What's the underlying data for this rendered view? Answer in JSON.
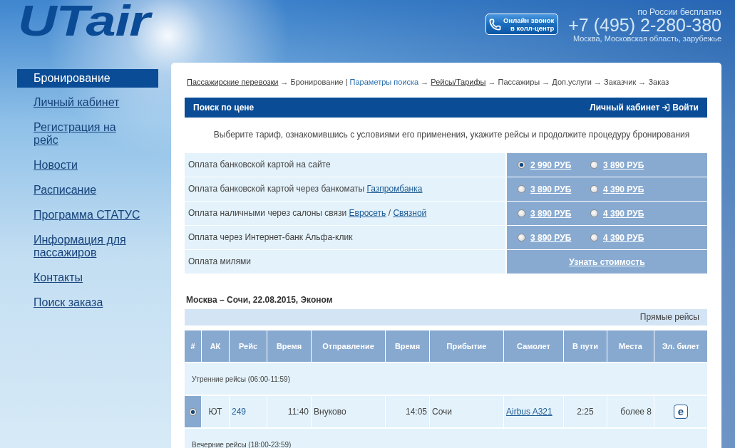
{
  "header": {
    "logo": "UTair",
    "callback_button": [
      "Онлайн звонок",
      "в колл-центр"
    ],
    "phone_note": "по России бесплатно",
    "phone": "+7 (495) 2-280-380",
    "phone_region": "Москва, Московская область, зарубежье"
  },
  "sidebar": {
    "items": [
      {
        "label": "Бронирование",
        "selected": true
      },
      {
        "label": "Личный кабинет",
        "selected": false
      },
      {
        "label": "Регистрация на рейс",
        "selected": false
      },
      {
        "label": "Новости",
        "selected": false
      },
      {
        "label": "Расписание",
        "selected": false
      },
      {
        "label": "Программа СТАТУС",
        "selected": false
      },
      {
        "label": "Информация для пассажиров",
        "selected": false
      },
      {
        "label": "Контакты",
        "selected": false
      },
      {
        "label": "Поиск заказа",
        "selected": false
      }
    ]
  },
  "breadcrumb": [
    {
      "text": "Пассажирские перевозки",
      "kind": "link"
    },
    {
      "text": " → Бронирование | ",
      "kind": "text"
    },
    {
      "text": "Параметры поиска",
      "kind": "current"
    },
    {
      "text": " → ",
      "kind": "text"
    },
    {
      "text": "Рейсы/Тарифы",
      "kind": "link"
    },
    {
      "text": " → Пассажиры → Доп.услуги → Заказчик → Заказ",
      "kind": "text"
    }
  ],
  "search_bar": {
    "title": "Поиск по цене",
    "account_link": "Личный кабинет",
    "login_link": "Войти"
  },
  "instruction": "Выберите тариф, ознакомившись с условиями его применения, укажите рейсы и продолжите процедуру бронирования",
  "payments": [
    {
      "kind": "fares",
      "label": [
        {
          "text": "Оплата банковской картой на сайте",
          "kind": "text"
        }
      ],
      "options": [
        {
          "price": "2 990 РУБ",
          "selected": true
        },
        {
          "price": "3 890 РУБ",
          "selected": false
        }
      ]
    },
    {
      "kind": "fares",
      "label": [
        {
          "text": "Оплата банковской картой через банкоматы ",
          "kind": "text"
        },
        {
          "text": "Газпромбанка",
          "kind": "link"
        }
      ],
      "options": [
        {
          "price": "3 890 РУБ",
          "selected": false
        },
        {
          "price": "4 390 РУБ",
          "selected": false
        }
      ]
    },
    {
      "kind": "fares",
      "label": [
        {
          "text": "Оплата наличными через салоны связи ",
          "kind": "text"
        },
        {
          "text": "Евросеть",
          "kind": "link"
        },
        {
          "text": " / ",
          "kind": "text"
        },
        {
          "text": "Связной",
          "kind": "link"
        }
      ],
      "options": [
        {
          "price": "3 890 РУБ",
          "selected": false
        },
        {
          "price": "4 390 РУБ",
          "selected": false
        }
      ]
    },
    {
      "kind": "fares",
      "label": [
        {
          "text": "Оплата через Интернет-банк Альфа-клик",
          "kind": "text"
        }
      ],
      "options": [
        {
          "price": "3 890 РУБ",
          "selected": false
        },
        {
          "price": "4 390 РУБ",
          "selected": false
        }
      ]
    },
    {
      "kind": "action",
      "label": [
        {
          "text": "Оплата милями",
          "kind": "text"
        }
      ],
      "action": "Узнать стоимость"
    }
  ],
  "route": {
    "title": "Москва – Сочи, 22.08.2015, Эконом",
    "filter": "Прямые рейсы",
    "columns": [
      "#",
      "АК",
      "Рейс",
      "Время",
      "Отправление",
      "Время",
      "Прибытие",
      "Самолет",
      "В пути",
      "Места",
      "Эл. билет"
    ],
    "groups": [
      {
        "label": "Утренние рейсы (06:00-11:59)",
        "flights": [
          {
            "selected": true,
            "airline": "ЮТ",
            "number": "249",
            "departure_time": "11:40",
            "departure": "Внуково",
            "arrival_time": "14:05",
            "arrival": "Сочи",
            "aircraft": "Airbus A321",
            "duration": "2:25",
            "seats": "более 8",
            "eticket": "e"
          }
        ]
      },
      {
        "label": "Вечерние рейсы (18:00-23:59)"
      }
    ]
  }
}
